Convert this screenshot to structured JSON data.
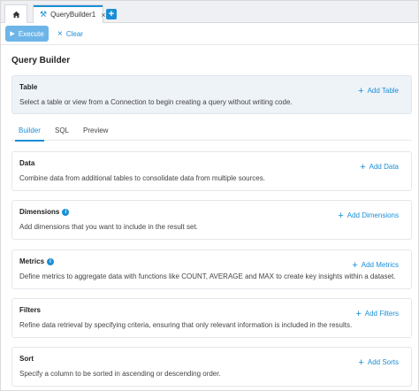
{
  "tabs": {
    "home_icon": "home-icon",
    "active_tab": "QueryBuilder1",
    "close_glyph": "×",
    "add_glyph": "+"
  },
  "toolbar": {
    "execute_label": "Execute",
    "clear_label": "Clear"
  },
  "page_title": "Query Builder",
  "table_panel": {
    "title": "Table",
    "description": "Select a table or view from a Connection to begin creating a query without writing code.",
    "action_label": "Add Table"
  },
  "view_tabs": [
    {
      "label": "Builder",
      "active": true
    },
    {
      "label": "SQL",
      "active": false
    },
    {
      "label": "Preview",
      "active": false
    }
  ],
  "sections": [
    {
      "title": "Data",
      "has_info": false,
      "description": "Combine data from additional tables to consolidate data from multiple sources.",
      "action_label": "Add Data"
    },
    {
      "title": "Dimensions",
      "has_info": true,
      "description": "Add dimensions that you want to include in the result set.",
      "action_label": "Add Dimensions"
    },
    {
      "title": "Metrics",
      "has_info": true,
      "description": "Define metrics to aggregate data with functions like COUNT, AVERAGE and MAX to create key insights within a dataset.",
      "action_label": "Add Metrics"
    },
    {
      "title": "Filters",
      "has_info": false,
      "description": "Refine data retrieval by specifying criteria, ensuring that only relevant information is included in the results.",
      "action_label": "Add Filters"
    },
    {
      "title": "Sort",
      "has_info": false,
      "description": "Specify a column to be sorted in ascending or descending order.",
      "action_label": "Add Sorts"
    }
  ],
  "colors": {
    "accent": "#1a8fd6",
    "execute_bg": "#6db5e8",
    "table_panel_bg": "#eef3f8"
  }
}
